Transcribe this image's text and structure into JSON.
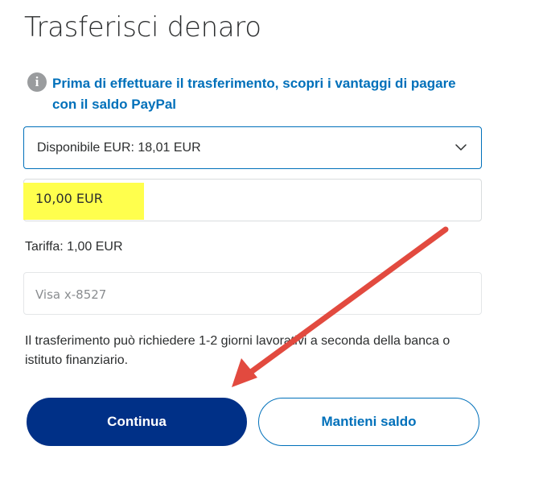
{
  "page": {
    "title": "Trasferisci denaro"
  },
  "info": {
    "icon": "info-icon",
    "glyph": "i",
    "link_text": "Prima di effettuare il trasferimento, scopri i vantaggi di pagare con il saldo PayPal"
  },
  "balance": {
    "selected": "Disponibile EUR: 18,01 EUR",
    "icon": "chevron-down-icon"
  },
  "amount": {
    "value": "10,00 EUR",
    "highlight_color": "#ffff4d"
  },
  "fee": {
    "text": "Tariffa: 1,00 EUR"
  },
  "card": {
    "placeholder": "Visa x-8527"
  },
  "notice": {
    "text": "Il trasferimento può richiedere 1-2 giorni lavorativi a seconda della banca o istituto finanziario."
  },
  "buttons": {
    "continue_label": "Continua",
    "keep_balance_label": "Mantieni saldo"
  },
  "colors": {
    "brand_dark": "#003087",
    "brand_blue": "#0070ba",
    "annotation_arrow": "#e24a3f"
  }
}
